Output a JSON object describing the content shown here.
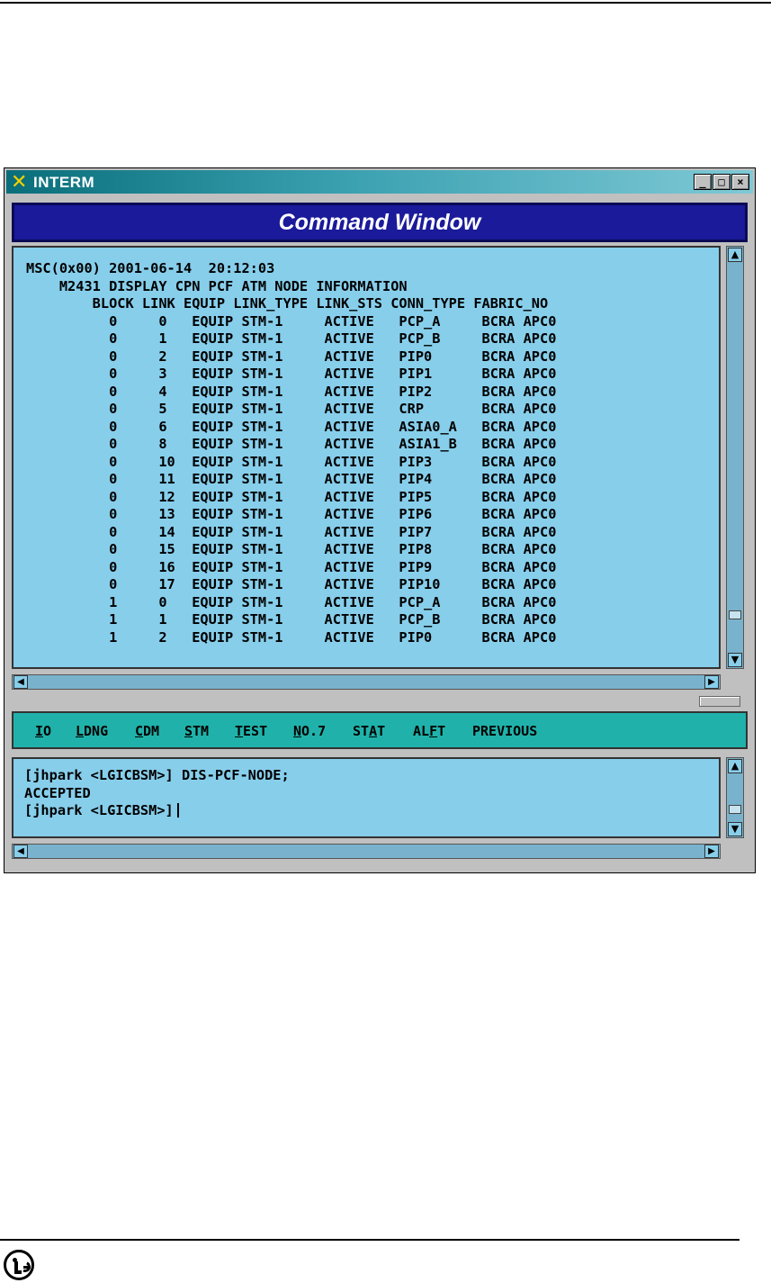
{
  "window": {
    "title": "INTERM",
    "icon": "x-logo-icon",
    "min_label": "_",
    "max_label": "□",
    "close_label": "×"
  },
  "header": {
    "title": "Command Window"
  },
  "output": {
    "lines": [
      "MSC(0x00) 2001-06-14  20:12:03",
      "    M2431 DISPLAY CPN PCF ATM NODE INFORMATION",
      "        BLOCK LINK EQUIP LINK_TYPE LINK_STS CONN_TYPE FABRIC_NO",
      "          0     0   EQUIP STM-1     ACTIVE   PCP_A     BCRA APC0",
      "          0     1   EQUIP STM-1     ACTIVE   PCP_B     BCRA APC0",
      "          0     2   EQUIP STM-1     ACTIVE   PIP0      BCRA APC0",
      "          0     3   EQUIP STM-1     ACTIVE   PIP1      BCRA APC0",
      "          0     4   EQUIP STM-1     ACTIVE   PIP2      BCRA APC0",
      "          0     5   EQUIP STM-1     ACTIVE   CRP       BCRA APC0",
      "          0     6   EQUIP STM-1     ACTIVE   ASIA0_A   BCRA APC0",
      "          0     8   EQUIP STM-1     ACTIVE   ASIA1_B   BCRA APC0",
      "          0     10  EQUIP STM-1     ACTIVE   PIP3      BCRA APC0",
      "          0     11  EQUIP STM-1     ACTIVE   PIP4      BCRA APC0",
      "          0     12  EQUIP STM-1     ACTIVE   PIP5      BCRA APC0",
      "          0     13  EQUIP STM-1     ACTIVE   PIP6      BCRA APC0",
      "          0     14  EQUIP STM-1     ACTIVE   PIP7      BCRA APC0",
      "          0     15  EQUIP STM-1     ACTIVE   PIP8      BCRA APC0",
      "          0     16  EQUIP STM-1     ACTIVE   PIP9      BCRA APC0",
      "          0     17  EQUIP STM-1     ACTIVE   PIP10     BCRA APC0",
      "          1     0   EQUIP STM-1     ACTIVE   PCP_A     BCRA APC0",
      "          1     1   EQUIP STM-1     ACTIVE   PCP_B     BCRA APC0",
      "          1     2   EQUIP STM-1     ACTIVE   PIP0      BCRA APC0"
    ]
  },
  "menu": {
    "items": [
      {
        "pre": "",
        "u": "I",
        "post": "O"
      },
      {
        "pre": "",
        "u": "L",
        "post": "DNG"
      },
      {
        "pre": "",
        "u": "C",
        "post": "DM"
      },
      {
        "pre": "",
        "u": "S",
        "post": "TM"
      },
      {
        "pre": "",
        "u": "T",
        "post": "EST"
      },
      {
        "pre": "",
        "u": "N",
        "post": "O.7"
      },
      {
        "pre": "ST",
        "u": "A",
        "post": "T"
      },
      {
        "pre": "AL",
        "u": "F",
        "post": "T"
      },
      {
        "pre": "PREVIOUS",
        "u": "",
        "post": ""
      }
    ]
  },
  "input": {
    "history": [
      "[jhpark <LGICBSM>] DIS-PCF-NODE;",
      "ACCEPTED"
    ],
    "prompt": "[jhpark <LGICBSM>]"
  },
  "icons": {
    "up": "▲",
    "down": "▼",
    "left": "◀",
    "right": "▶"
  },
  "colors": {
    "pane_bg": "#87ceeb",
    "menu_bg": "#20b2aa",
    "header_bg": "#1a1a9a"
  }
}
